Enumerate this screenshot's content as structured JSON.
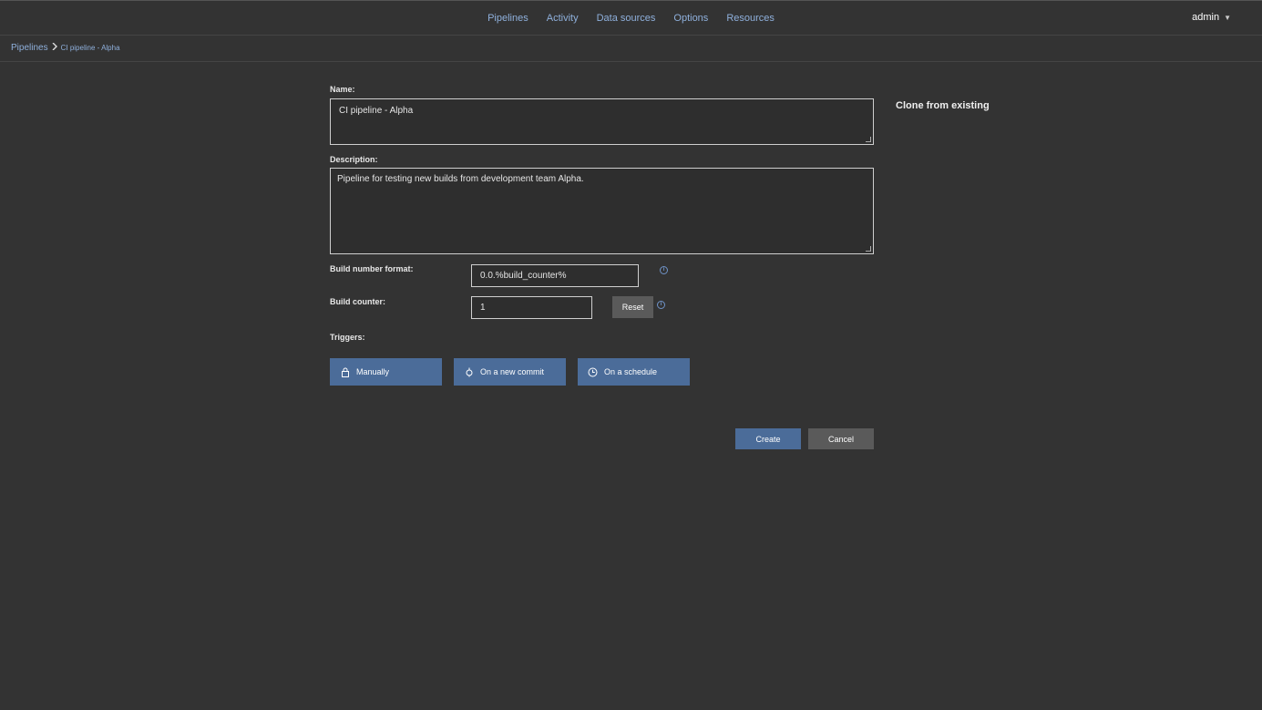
{
  "nav": {
    "items": [
      "Pipelines",
      "Activity",
      "Data sources",
      "Options",
      "Resources"
    ],
    "user": "admin"
  },
  "breadcrumb": {
    "root": "Pipelines",
    "current": "CI pipeline - Alpha"
  },
  "form": {
    "name_label": "Name:",
    "name_value": "CI pipeline - Alpha",
    "description_label": "Description:",
    "description_value": "Pipeline for testing new builds from development team Alpha.",
    "build_number_format_label": "Build number format:",
    "build_number_format_value": "0.0.%build_counter%",
    "build_counter_label": "Build counter:",
    "build_counter_value": "1",
    "reset_label": "Reset",
    "triggers_label": "Triggers:",
    "triggers": [
      {
        "label": "Manually",
        "icon": "lock-icon"
      },
      {
        "label": "On a new commit",
        "icon": "commit-icon"
      },
      {
        "label": "On a schedule",
        "icon": "clock-icon"
      }
    ],
    "create_label": "Create",
    "cancel_label": "Cancel"
  },
  "sidebar": {
    "clone_label": "Clone from existing"
  },
  "colors": {
    "background": "#333333",
    "accent": "#4b6c99",
    "link": "#8fb0dc",
    "button_grey": "#5a5a5a"
  }
}
